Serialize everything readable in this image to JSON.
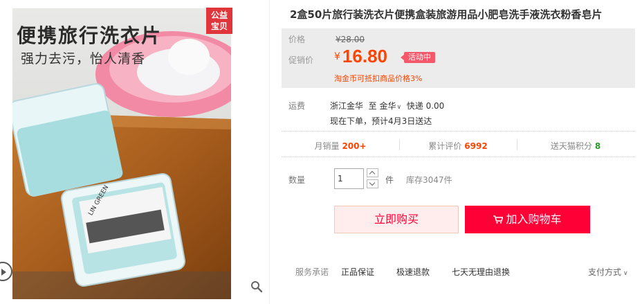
{
  "gallery": {
    "photo_title": "便携旅行洗衣片",
    "photo_subtitle": "强力去污，怡人清香",
    "box_brand": "LIN GREEN",
    "charity_badge": [
      "公益",
      "宝贝"
    ]
  },
  "product": {
    "title": "2盒50片旅行装洗衣片便携盒装旅游用品小肥皂洗手液洗衣粉香皂片"
  },
  "price": {
    "label": "价格",
    "original": "¥28.00",
    "promo_label": "促销价",
    "currency": "¥",
    "promo_value": "16.80",
    "promo_badge": "活动中",
    "coin_note": "淘金币可抵扣商品价格3%"
  },
  "shipping": {
    "label": "运费",
    "from": "浙江金华",
    "to_prefix": "至",
    "to": "金华",
    "method": "快递",
    "fee": "0.00",
    "eta": "现在下单，预计4月3日送达"
  },
  "stats": [
    {
      "label": "月销量",
      "value": "200+",
      "color": "#ff4400"
    },
    {
      "label": "累计评价",
      "value": "6992",
      "color": "#ff4400"
    },
    {
      "label": "送天猫积分",
      "value": "8",
      "color": "#2a9a2a"
    }
  ],
  "quantity": {
    "label": "数量",
    "value": "1",
    "unit": "件",
    "stock": "库存3047件"
  },
  "buttons": {
    "buy_now": "立即购买",
    "add_cart": "加入购物车"
  },
  "service": {
    "label": "服务承诺",
    "items": [
      "正品保证",
      "极速退款",
      "七天无理由退换"
    ],
    "payment": "支付方式"
  },
  "colors": {
    "accent": "#ff0036",
    "price": "#ff4400",
    "badge": "#e0353a"
  }
}
